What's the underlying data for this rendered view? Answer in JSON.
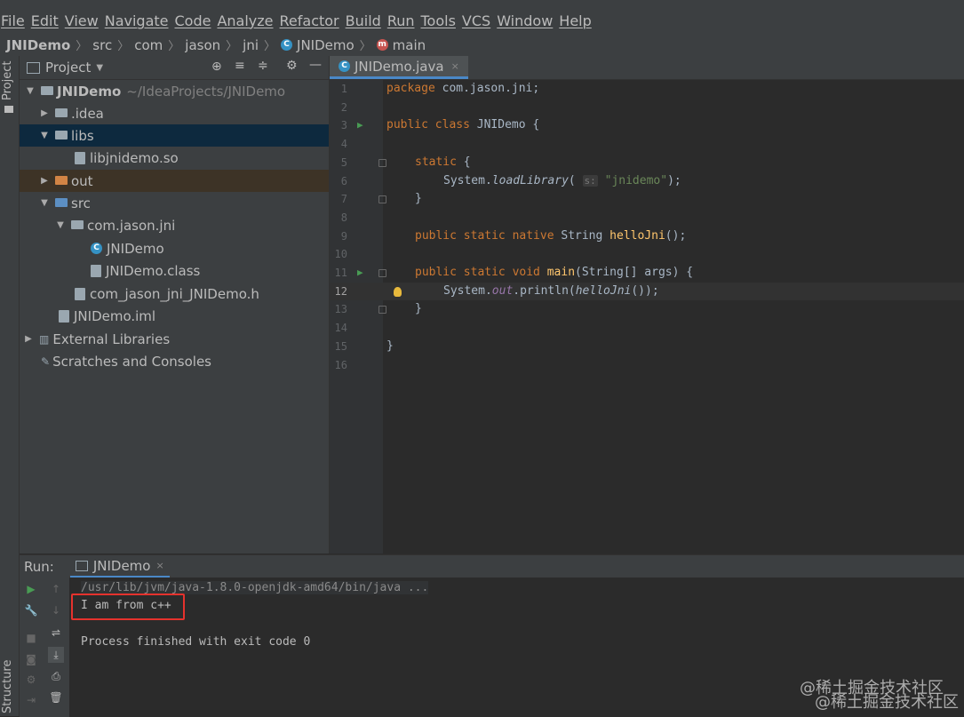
{
  "menu": [
    "File",
    "Edit",
    "View",
    "Navigate",
    "Code",
    "Analyze",
    "Refactor",
    "Build",
    "Run",
    "Tools",
    "VCS",
    "Window",
    "Help"
  ],
  "breadcrumb": {
    "project": "JNIDemo",
    "parts": [
      "src",
      "com",
      "jason",
      "jni"
    ],
    "class": "JNIDemo",
    "method": "main"
  },
  "side_labels": {
    "project": "Project",
    "structure": "Structure"
  },
  "project_panel": {
    "title": "Project",
    "root_name": "JNIDemo",
    "root_path": "~/IdeaProjects/JNIDemo",
    "items": [
      {
        "label": "JNIDemo",
        "type": "root"
      },
      {
        "label": ".idea",
        "type": "folder"
      },
      {
        "label": "libs",
        "type": "folder"
      },
      {
        "label": "libjnidemo.so",
        "type": "file"
      },
      {
        "label": "out",
        "type": "folder"
      },
      {
        "label": "src",
        "type": "folder"
      },
      {
        "label": "com.jason.jni",
        "type": "package"
      },
      {
        "label": "JNIDemo",
        "type": "class"
      },
      {
        "label": "JNIDemo.class",
        "type": "file"
      },
      {
        "label": "com_jason_jni_JNIDemo.h",
        "type": "file"
      },
      {
        "label": "JNIDemo.iml",
        "type": "file"
      },
      {
        "label": "External Libraries",
        "type": "lib"
      },
      {
        "label": "Scratches and Consoles",
        "type": "scratch"
      }
    ]
  },
  "editor": {
    "tab": "JNIDemo.java",
    "line_numbers": [
      "1",
      "2",
      "3",
      "4",
      "5",
      "6",
      "7",
      "8",
      "9",
      "10",
      "11",
      "12",
      "13",
      "14",
      "15",
      "16"
    ],
    "current_line": "12",
    "code": {
      "l1_kw": "package",
      "l1_rest": " com.jason.jni;",
      "l3_kw1": "public",
      "l3_kw2": "class",
      "l3_rest": " JNIDemo {",
      "l5_kw": "static",
      "l5_rest": " {",
      "l6_pre": "System.",
      "l6_fn": "loadLibrary",
      "l6_paren": "(",
      "l6_hint": "s:",
      "l6_str": "\"jnidemo\"",
      "l6_end": ");",
      "l7": "}",
      "l9_kw": "public static native",
      "l9_type": " String ",
      "l9_fn": "helloJni",
      "l9_end": "();",
      "l11_kw": "public static void",
      "l11_fn": "main",
      "l11_rest": "(String[] args) {",
      "l12_pre": "System.",
      "l12_out": "out",
      "l12_dot": ".",
      "l12_fn": "println",
      "l12_paren": "(",
      "l12_call": "helloJni",
      "l12_end": "());",
      "l13": "}",
      "l15": "}"
    }
  },
  "run": {
    "label": "Run:",
    "tab": "JNIDemo",
    "console": [
      "/usr/lib/jvm/java-1.8.0-openjdk-amd64/bin/java ...",
      "I am from c++",
      "Process finished with exit code 0"
    ]
  },
  "watermark": "@稀土掘金技术社区",
  "colors": {
    "accent": "#4a88c7",
    "highlight_box": "#e5322d",
    "keyword": "#cc7832",
    "string": "#6a8759",
    "function": "#ffc66d"
  }
}
